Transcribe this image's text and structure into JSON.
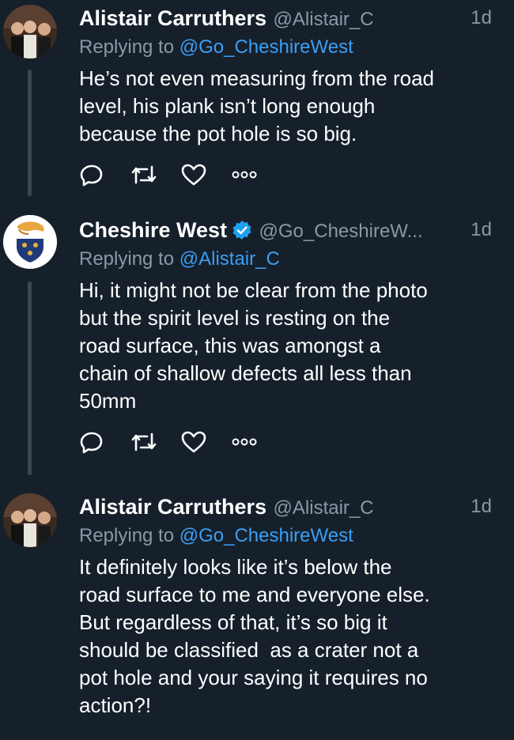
{
  "tweets": [
    {
      "author": "Alistair Carruthers",
      "handle": "@Alistair_C",
      "time": "1d",
      "replying_prefix": "Replying to ",
      "replying_to": "@Go_CheshireWest",
      "body_lines": [
        "He’s not even measuring from the road",
        "level, his plank isn’t long enough",
        "because the pot hole is so big."
      ]
    },
    {
      "author": "Cheshire West",
      "handle": "@Go_CheshireW...",
      "time": "1d",
      "replying_prefix": "Replying to ",
      "replying_to": "@Alistair_C",
      "body_lines": [
        "Hi, it might not be clear from the photo",
        "but the spirit level is resting on the",
        "road surface, this was amongst a",
        "chain of shallow defects all less than",
        "50mm"
      ]
    },
    {
      "author": "Alistair Carruthers",
      "handle": "@Alistair_C",
      "time": "1d",
      "replying_prefix": "Replying to ",
      "replying_to": "@Go_CheshireWest",
      "body_lines": [
        "It definitely looks like it’s below the",
        "road surface to me and everyone else.",
        "But regardless of that, it’s so big it",
        "should be classified  as a crater not a",
        "pot hole and your saying it requires no",
        "action?!"
      ]
    }
  ],
  "icons": {
    "reply": "reply-icon",
    "retweet": "retweet-icon",
    "like": "heart-icon",
    "more": "more-icon",
    "verified": "verified-badge-icon"
  },
  "colors": {
    "background": "#16202b",
    "secondary_text": "#8899a6",
    "link": "#3b9ef5",
    "verified": "#1da1f2"
  }
}
